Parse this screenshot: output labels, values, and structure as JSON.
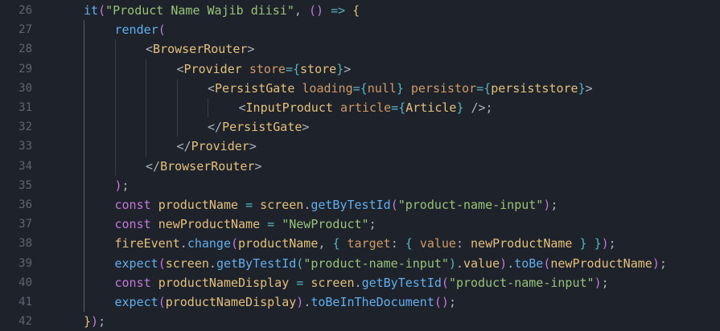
{
  "editor": {
    "lines": [
      {
        "num": "26",
        "indent": 1,
        "tokens": [
          [
            "t-fn",
            "it"
          ],
          [
            "t-brace",
            "("
          ],
          [
            "t-str",
            "\"Product Name Wajib diisi\""
          ],
          [
            "t-punct",
            ", "
          ],
          [
            "t-kw",
            "("
          ],
          [
            "t-kw",
            ")"
          ],
          [
            "t-punct",
            " "
          ],
          [
            "t-op",
            "=>"
          ],
          [
            "t-punct",
            " "
          ],
          [
            "t-tag",
            "{"
          ]
        ]
      },
      {
        "num": "27",
        "indent": 2,
        "tokens": [
          [
            "t-fn",
            "render"
          ],
          [
            "t-brace",
            "("
          ]
        ]
      },
      {
        "num": "28",
        "indent": 3,
        "tokens": [
          [
            "t-punct",
            "<"
          ],
          [
            "t-tag",
            "BrowserRouter"
          ],
          [
            "t-punct",
            ">"
          ]
        ]
      },
      {
        "num": "29",
        "indent": 4,
        "tokens": [
          [
            "t-punct",
            "<"
          ],
          [
            "t-tag",
            "Provider"
          ],
          [
            "t-punct",
            " "
          ],
          [
            "t-attr",
            "store"
          ],
          [
            "t-op",
            "="
          ],
          [
            "t-brace2",
            "{"
          ],
          [
            "t-var",
            "store"
          ],
          [
            "t-brace2",
            "}"
          ],
          [
            "t-punct",
            ">"
          ]
        ]
      },
      {
        "num": "30",
        "indent": 5,
        "tokens": [
          [
            "t-punct",
            "<"
          ],
          [
            "t-tag",
            "PersistGate"
          ],
          [
            "t-punct",
            " "
          ],
          [
            "t-attr",
            "loading"
          ],
          [
            "t-op",
            "="
          ],
          [
            "t-brace2",
            "{"
          ],
          [
            "t-attr",
            "null"
          ],
          [
            "t-brace2",
            "}"
          ],
          [
            "t-punct",
            " "
          ],
          [
            "t-attr",
            "persistor"
          ],
          [
            "t-op",
            "="
          ],
          [
            "t-brace2",
            "{"
          ],
          [
            "t-var",
            "persiststore"
          ],
          [
            "t-brace2",
            "}"
          ],
          [
            "t-punct",
            ">"
          ]
        ]
      },
      {
        "num": "31",
        "indent": 6,
        "tokens": [
          [
            "t-punct",
            "<"
          ],
          [
            "t-tag",
            "InputProduct"
          ],
          [
            "t-punct",
            " "
          ],
          [
            "t-attr",
            "article"
          ],
          [
            "t-op",
            "="
          ],
          [
            "t-brace2",
            "{"
          ],
          [
            "t-var",
            "Article"
          ],
          [
            "t-brace2",
            "}"
          ],
          [
            "t-punct",
            " />;"
          ]
        ]
      },
      {
        "num": "32",
        "indent": 5,
        "tokens": [
          [
            "t-punct",
            "</"
          ],
          [
            "t-tag",
            "PersistGate"
          ],
          [
            "t-punct",
            ">"
          ]
        ]
      },
      {
        "num": "33",
        "indent": 4,
        "tokens": [
          [
            "t-punct",
            "</"
          ],
          [
            "t-tag",
            "Provider"
          ],
          [
            "t-punct",
            ">"
          ]
        ]
      },
      {
        "num": "34",
        "indent": 3,
        "tokens": [
          [
            "t-punct",
            "</"
          ],
          [
            "t-tag",
            "BrowserRouter"
          ],
          [
            "t-punct",
            ">"
          ]
        ]
      },
      {
        "num": "35",
        "indent": 2,
        "tokens": [
          [
            "t-brace",
            ")"
          ],
          [
            "t-punct",
            ";"
          ]
        ]
      },
      {
        "num": "36",
        "indent": 2,
        "tokens": [
          [
            "t-kw",
            "const"
          ],
          [
            "t-punct",
            " "
          ],
          [
            "t-var",
            "productName"
          ],
          [
            "t-punct",
            " "
          ],
          [
            "t-op",
            "="
          ],
          [
            "t-punct",
            " "
          ],
          [
            "t-var",
            "screen"
          ],
          [
            "t-punct",
            "."
          ],
          [
            "t-fn",
            "getByTestId"
          ],
          [
            "t-brace",
            "("
          ],
          [
            "t-str",
            "\"product-name-input\""
          ],
          [
            "t-brace",
            ")"
          ],
          [
            "t-punct",
            ";"
          ]
        ]
      },
      {
        "num": "37",
        "indent": 2,
        "tokens": [
          [
            "t-kw",
            "const"
          ],
          [
            "t-punct",
            " "
          ],
          [
            "t-var",
            "newProductName"
          ],
          [
            "t-punct",
            " "
          ],
          [
            "t-op",
            "="
          ],
          [
            "t-punct",
            " "
          ],
          [
            "t-str",
            "\"NewProduct\""
          ],
          [
            "t-punct",
            ";"
          ]
        ]
      },
      {
        "num": "38",
        "indent": 2,
        "tokens": [
          [
            "t-var",
            "fireEvent"
          ],
          [
            "t-punct",
            "."
          ],
          [
            "t-fn",
            "change"
          ],
          [
            "t-brace",
            "("
          ],
          [
            "t-var",
            "productName"
          ],
          [
            "t-punct",
            ", "
          ],
          [
            "t-brace2",
            "{"
          ],
          [
            "t-punct",
            " "
          ],
          [
            "t-attr",
            "target"
          ],
          [
            "t-punct",
            ": "
          ],
          [
            "t-brace2",
            "{"
          ],
          [
            "t-punct",
            " "
          ],
          [
            "t-attr",
            "value"
          ],
          [
            "t-punct",
            ": "
          ],
          [
            "t-var",
            "newProductName"
          ],
          [
            "t-punct",
            " "
          ],
          [
            "t-brace2",
            "}"
          ],
          [
            "t-punct",
            " "
          ],
          [
            "t-brace2",
            "}"
          ],
          [
            "t-brace",
            ")"
          ],
          [
            "t-punct",
            ";"
          ]
        ]
      },
      {
        "num": "39",
        "indent": 2,
        "tokens": [
          [
            "t-fn",
            "expect"
          ],
          [
            "t-brace",
            "("
          ],
          [
            "t-var",
            "screen"
          ],
          [
            "t-punct",
            "."
          ],
          [
            "t-fn",
            "getByTestId"
          ],
          [
            "t-brace2",
            "("
          ],
          [
            "t-str",
            "\"product-name-input\""
          ],
          [
            "t-brace2",
            ")"
          ],
          [
            "t-punct",
            "."
          ],
          [
            "t-var",
            "value"
          ],
          [
            "t-brace",
            ")"
          ],
          [
            "t-punct",
            "."
          ],
          [
            "t-fn",
            "toBe"
          ],
          [
            "t-brace",
            "("
          ],
          [
            "t-var",
            "newProductName"
          ],
          [
            "t-brace",
            ")"
          ],
          [
            "t-punct",
            ";"
          ]
        ]
      },
      {
        "num": "40",
        "indent": 2,
        "tokens": [
          [
            "t-kw",
            "const"
          ],
          [
            "t-punct",
            " "
          ],
          [
            "t-var",
            "productNameDisplay"
          ],
          [
            "t-punct",
            " "
          ],
          [
            "t-op",
            "="
          ],
          [
            "t-punct",
            " "
          ],
          [
            "t-var",
            "screen"
          ],
          [
            "t-punct",
            "."
          ],
          [
            "t-fn",
            "getByTestId"
          ],
          [
            "t-brace",
            "("
          ],
          [
            "t-str",
            "\"product-name-input\""
          ],
          [
            "t-brace",
            ")"
          ],
          [
            "t-punct",
            ";"
          ]
        ]
      },
      {
        "num": "41",
        "indent": 2,
        "tokens": [
          [
            "t-fn",
            "expect"
          ],
          [
            "t-brace",
            "("
          ],
          [
            "t-var",
            "productNameDisplay"
          ],
          [
            "t-brace",
            ")"
          ],
          [
            "t-punct",
            "."
          ],
          [
            "t-fn",
            "toBeInTheDocument"
          ],
          [
            "t-brace",
            "("
          ],
          [
            "t-brace",
            ")"
          ],
          [
            "t-punct",
            ";"
          ]
        ]
      },
      {
        "num": "42",
        "indent": 1,
        "tokens": [
          [
            "t-tag",
            "}"
          ],
          [
            "t-brace",
            ")"
          ],
          [
            "t-punct",
            ";"
          ]
        ]
      }
    ]
  }
}
